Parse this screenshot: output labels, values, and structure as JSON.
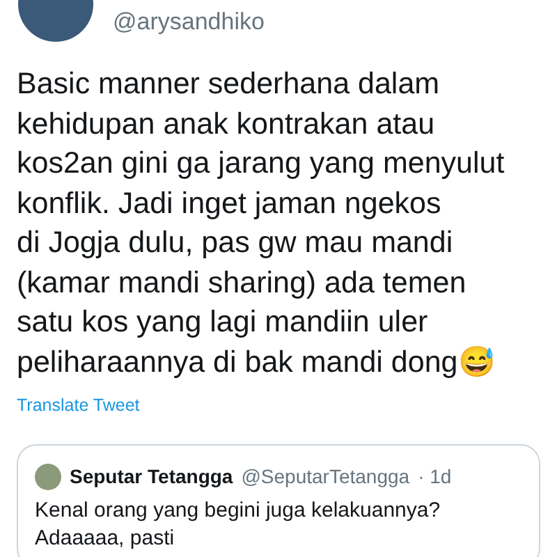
{
  "author": {
    "handle": "@arysandhiko"
  },
  "tweet_lines": [
    "Basic manner sederhana dalam",
    "kehidupan anak kontrakan atau",
    "kos2an gini ga jarang yang menyulut",
    "konflik. Jadi inget jaman ngekos",
    "di Jogja dulu, pas gw mau mandi",
    "(kamar mandi sharing) ada temen",
    "satu kos yang lagi mandiin uler",
    "peliharaannya di bak mandi dong😅"
  ],
  "translate_link": "Translate Tweet",
  "quoted_tweet": {
    "name": "Seputar Tetangga",
    "handle": "@SeputarTetangga",
    "time": "· 1d",
    "lines": [
      "Kenal orang yang begini juga kelakuannya?",
      "Adaaaaa, pasti"
    ]
  }
}
